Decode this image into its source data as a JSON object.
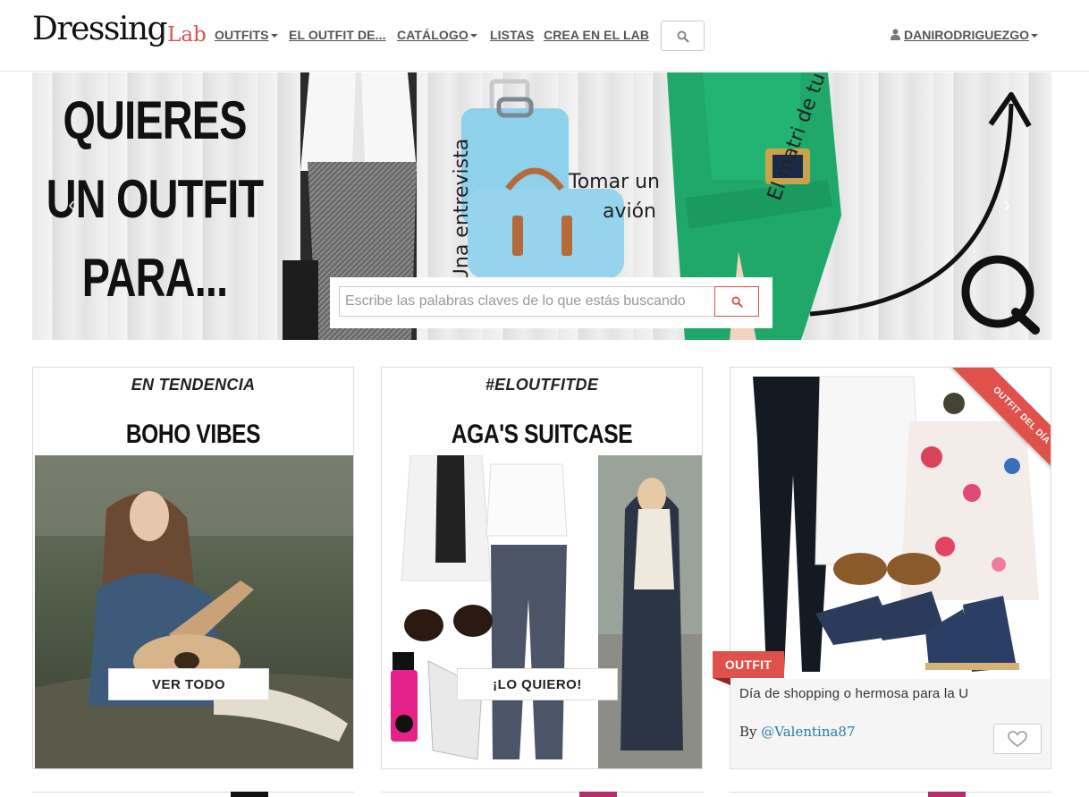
{
  "logo": {
    "part1": "Dressing",
    "part2": "Lab"
  },
  "nav": {
    "items": [
      {
        "label": "OUTFITS",
        "dropdown": true
      },
      {
        "label": "EL OUTFIT DE...",
        "dropdown": false
      },
      {
        "label": "CATÁLOGO",
        "dropdown": true
      },
      {
        "label": "LISTAS",
        "dropdown": false
      },
      {
        "label": "CREA EN EL LAB",
        "dropdown": false
      }
    ],
    "search_icon": "search-icon",
    "user": {
      "name": "DANIRODRIGUEZGO",
      "icon": "user-icon"
    }
  },
  "hero": {
    "title_lines": [
      "QUIERES",
      "UN OUTFIT",
      "PARA..."
    ],
    "phrase_interview": "Una entrevista",
    "phrase_plane_1": "Tomar un",
    "phrase_plane_2": "avión",
    "phrase_wedding": "El matri de tu amiga",
    "search_placeholder": "Escribe las palabras claves de lo que estás buscando",
    "search_icon": "search-icon"
  },
  "cards": [
    {
      "kicker": "EN TENDENCIA",
      "title": "BOHO VIBES",
      "cta": "VER TODO"
    },
    {
      "kicker": "#ELOUTFITDE",
      "title": "AGA'S SUITCASE",
      "cta": "¡LO QUIERO!"
    }
  ],
  "outfit_card": {
    "ribbon": "OUTFIT DEL DÍA",
    "tag": "OUTFIT",
    "description": "Día de shopping o hermosa para la U",
    "by_prefix": "By ",
    "handle": "@Valentina87",
    "like_icon": "heart-icon"
  },
  "colors": {
    "accent": "#e0514c",
    "link": "#2a7aa8",
    "nav_text": "#555555"
  }
}
